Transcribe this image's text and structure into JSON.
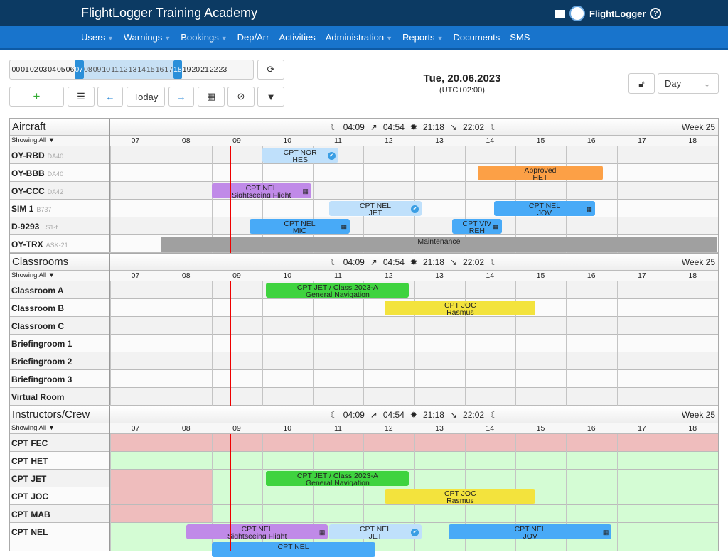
{
  "header": {
    "title": "FlightLogger Training Academy",
    "brand": "FlightLogger",
    "help": "?"
  },
  "nav": [
    {
      "label": "Users",
      "dd": true
    },
    {
      "label": "Warnings",
      "dd": true
    },
    {
      "label": "Bookings",
      "dd": true
    },
    {
      "label": "Dep/Arr",
      "dd": false
    },
    {
      "label": "Activities",
      "dd": false
    },
    {
      "label": "Administration",
      "dd": true
    },
    {
      "label": "Reports",
      "dd": true
    },
    {
      "label": "Documents",
      "dd": false
    },
    {
      "label": "SMS",
      "dd": false
    }
  ],
  "hour_range": {
    "hours": [
      "00",
      "01",
      "02",
      "03",
      "04",
      "05",
      "06",
      "07",
      "08",
      "09",
      "10",
      "11",
      "12",
      "13",
      "14",
      "15",
      "16",
      "17",
      "18",
      "19",
      "20",
      "21",
      "22",
      "23"
    ],
    "start": 7,
    "end": 18
  },
  "toolbar": {
    "add": "+",
    "today": "Today",
    "view": "Day"
  },
  "date": "Tue, 20.06.2023",
  "timezone": "(UTC+02:00)",
  "sun": {
    "t1": "04:09",
    "t2": "04:54",
    "t3": "21:18",
    "t4": "22:02"
  },
  "week": "Week 25",
  "showing": "Showing All",
  "timeline_hours": [
    "07",
    "08",
    "09",
    "10",
    "11",
    "12",
    "13",
    "14",
    "15",
    "16",
    "17",
    "18"
  ],
  "now_hour": 9.375,
  "colors": {
    "lightblue": "#bfe0fb",
    "blue": "#48aaf7",
    "purple": "#c08ae8",
    "orange": "#fca046",
    "gray": "#a0a0a0",
    "green": "#3fd33f",
    "yellow": "#f3e33d",
    "pink": "#efbdbd",
    "avail": "#d4fcd4"
  },
  "sections": [
    {
      "title": "Aircraft",
      "rows": [
        {
          "name": "OY-RBD",
          "type": "DA40",
          "events": [
            {
              "s": 10,
              "e": 11.5,
              "l1": "CPT NOR",
              "l2": "HES",
              "c": "lightblue",
              "icon": "check"
            }
          ]
        },
        {
          "name": "OY-BBB",
          "type": "DA40",
          "events": [
            {
              "s": 14.25,
              "e": 16.73,
              "l1": "Approved",
              "l2": "HET",
              "c": "orange"
            }
          ]
        },
        {
          "name": "OY-CCC",
          "type": "DA42",
          "events": [
            {
              "s": 9,
              "e": 10.97,
              "l1": "CPT NEL",
              "l2": "Sightseeing Flight",
              "c": "purple",
              "icon": "calendar"
            }
          ]
        },
        {
          "name": "SIM 1",
          "type": "B737",
          "events": [
            {
              "s": 11.32,
              "e": 13.15,
              "l1": "CPT NEL",
              "l2": "JET",
              "c": "lightblue",
              "icon": "check"
            },
            {
              "s": 14.58,
              "e": 16.57,
              "l1": "CPT NEL",
              "l2": "JOV",
              "c": "blue",
              "icon": "calendar"
            }
          ]
        },
        {
          "name": "D-9293",
          "type": "LS1-f",
          "events": [
            {
              "s": 9.75,
              "e": 11.73,
              "l1": "CPT NEL",
              "l2": "MIC",
              "c": "blue",
              "icon": "calendar"
            },
            {
              "s": 13.75,
              "e": 14.73,
              "l1": "CPT VIV",
              "l2": "REH",
              "c": "blue",
              "icon": "calendar"
            }
          ]
        },
        {
          "name": "OY-TRX",
          "type": "ASK-21",
          "events": [
            {
              "s": 8,
              "e": 18.98,
              "l1": "Maintenance",
              "l2": "",
              "c": "gray"
            }
          ]
        }
      ]
    },
    {
      "title": "Classrooms",
      "rows": [
        {
          "name": "Classroom A",
          "events": [
            {
              "s": 10.08,
              "e": 12.9,
              "l1": "CPT JET / Class 2023-A",
              "l2": "General Navigation",
              "c": "green"
            }
          ]
        },
        {
          "name": "Classroom B",
          "events": [
            {
              "s": 12.42,
              "e": 15.4,
              "l1": "CPT JOC",
              "l2": "Rasmus",
              "c": "yellow"
            }
          ]
        },
        {
          "name": "Classroom C",
          "events": []
        },
        {
          "name": "Briefingroom 1",
          "events": []
        },
        {
          "name": "Briefingroom 2",
          "events": []
        },
        {
          "name": "Briefingroom 3",
          "events": []
        },
        {
          "name": "Virtual Room",
          "events": []
        }
      ]
    },
    {
      "title": "Instructors/Crew",
      "rows": [
        {
          "name": "CPT FEC",
          "bg": [
            {
              "s": 7,
              "e": 19,
              "c": "pink"
            }
          ],
          "events": []
        },
        {
          "name": "CPT HET",
          "bg": [
            {
              "s": 7,
              "e": 19,
              "c": "avail"
            }
          ],
          "events": []
        },
        {
          "name": "CPT JET",
          "bg": [
            {
              "s": 7,
              "e": 9,
              "c": "pink"
            },
            {
              "s": 9,
              "e": 19,
              "c": "avail"
            }
          ],
          "events": [
            {
              "s": 10.08,
              "e": 12.9,
              "l1": "CPT JET / Class 2023-A",
              "l2": "General Navigation",
              "c": "green"
            }
          ]
        },
        {
          "name": "CPT JOC",
          "bg": [
            {
              "s": 7,
              "e": 9,
              "c": "pink"
            },
            {
              "s": 9,
              "e": 19,
              "c": "avail"
            }
          ],
          "events": [
            {
              "s": 12.42,
              "e": 15.4,
              "l1": "CPT JOC",
              "l2": "Rasmus",
              "c": "yellow"
            }
          ]
        },
        {
          "name": "CPT MAB",
          "bg": [
            {
              "s": 7,
              "e": 9,
              "c": "pink"
            },
            {
              "s": 9,
              "e": 19,
              "c": "avail"
            }
          ],
          "events": []
        },
        {
          "name": "CPT NEL",
          "tall": true,
          "bg": [
            {
              "s": 7,
              "e": 19,
              "c": "avail"
            }
          ],
          "events": [
            {
              "s": 8.5,
              "e": 11.3,
              "l1": "CPT NEL",
              "l2": "Sightseeing Flight",
              "c": "purple",
              "icon": "calendar"
            },
            {
              "s": 11.32,
              "e": 13.15,
              "l1": "CPT NEL",
              "l2": "JET",
              "c": "lightblue",
              "icon": "check"
            },
            {
              "s": 13.68,
              "e": 16.9,
              "l1": "CPT NEL",
              "l2": "JOV",
              "c": "blue",
              "icon": "calendar"
            },
            {
              "s": 9,
              "e": 12.23,
              "l1": "CPT NEL",
              "l2": "",
              "c": "blue",
              "lane": 1
            }
          ]
        }
      ]
    }
  ]
}
